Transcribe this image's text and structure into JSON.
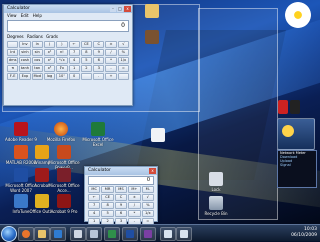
{
  "calc_main": {
    "title": "Calculator",
    "menu": "View  Edit  Help",
    "display": "0",
    "radios": [
      "Degrees",
      "Radians",
      "Grads"
    ],
    "keys": [
      [
        "",
        "Inv",
        "ln",
        "(",
        ")",
        "←",
        "CE",
        "C",
        "±",
        "√"
      ],
      [
        "Int",
        "sinh",
        "sin",
        "x²",
        "n!",
        "7",
        "8",
        "9",
        "/",
        "%"
      ],
      [
        "dms",
        "cosh",
        "cos",
        "xʸ",
        "ʸ√x",
        "4",
        "5",
        "6",
        "*",
        "1/x"
      ],
      [
        "π",
        "tanh",
        "tan",
        "x³",
        "∛x",
        "1",
        "2",
        "3",
        "-",
        "="
      ],
      [
        "F-E",
        "Exp",
        "Mod",
        "log",
        "10ˣ",
        "0",
        "",
        ".",
        "+",
        ""
      ]
    ]
  },
  "calc_small": {
    "title": "Calculator",
    "display": "0",
    "keys": [
      "MC",
      "MR",
      "MS",
      "M+",
      "M-",
      "←",
      "CE",
      "C",
      "±",
      "√",
      "7",
      "8",
      "9",
      "/",
      "%",
      "4",
      "5",
      "6",
      "*",
      "1/x",
      "1",
      "2",
      "3",
      "-",
      "=",
      "0",
      "",
      ".",
      "+",
      ""
    ]
  },
  "desktop_icons": [
    "Adobe Reader 9",
    "Mozilla Firefox",
    "Microsoft Office Excel",
    "MATLAB R2008",
    "Winamp",
    "Microsoft Office PowerP...",
    "Microsoft Office Word 2007",
    "Acrobat",
    "Microsoft Office Acce...",
    "InfoTune",
    "Office Outl...",
    "Acrobat 9 Pro",
    "Lock",
    "Recycle Bin"
  ],
  "gadget_net": {
    "title": "Network Meter",
    "rows": [
      "Download",
      "Upload",
      "Signal"
    ]
  },
  "clock": {
    "time": "10:03",
    "date": "06/10/2009"
  }
}
